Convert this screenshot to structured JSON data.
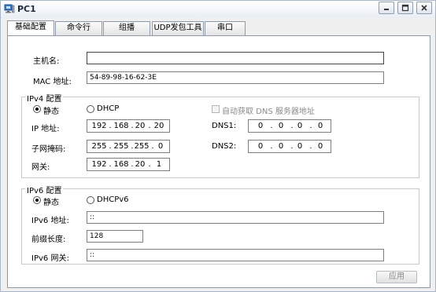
{
  "window": {
    "title": "PC1"
  },
  "tabs": [
    {
      "label": "基础配置"
    },
    {
      "label": "命令行"
    },
    {
      "label": "组播"
    },
    {
      "label": "UDP发包工具"
    },
    {
      "label": "串口"
    }
  ],
  "basic": {
    "hostname_label": "主机名:",
    "hostname_value": "",
    "mac_label": "MAC 地址:",
    "mac_value": "54-89-98-16-62-3E"
  },
  "ipv4": {
    "group_title": "IPv4 配置",
    "static_label": "静态",
    "dhcp_label": "DHCP",
    "auto_dns_label": "自动获取 DNS 服务器地址",
    "ip_label": "IP 地址:",
    "ip": [
      "192",
      "168",
      "20",
      "20"
    ],
    "mask_label": "子网掩码:",
    "mask": [
      "255",
      "255",
      "255",
      "0"
    ],
    "gateway_label": "网关:",
    "gateway": [
      "192",
      "168",
      "20",
      "1"
    ],
    "dns1_label": "DNS1:",
    "dns1": [
      "0",
      "0",
      "0",
      "0"
    ],
    "dns2_label": "DNS2:",
    "dns2": [
      "0",
      "0",
      "0",
      "0"
    ],
    "mode_selected": "静态"
  },
  "ipv6": {
    "group_title": "IPv6 配置",
    "static_label": "静态",
    "dhcp_label": "DHCPv6",
    "ip_label": "IPv6 地址:",
    "ip_value": "::",
    "prefix_label": "前缀长度:",
    "prefix_value": "128",
    "gateway_label": "IPv6 网关:",
    "gateway_value": "::",
    "mode_selected": "静态"
  },
  "actions": {
    "apply_label": "应用"
  },
  "colors": {
    "panel_bg": "#ffffff",
    "window_bg": "#f0f0f0",
    "disabled_text": "#8a8a8a"
  }
}
